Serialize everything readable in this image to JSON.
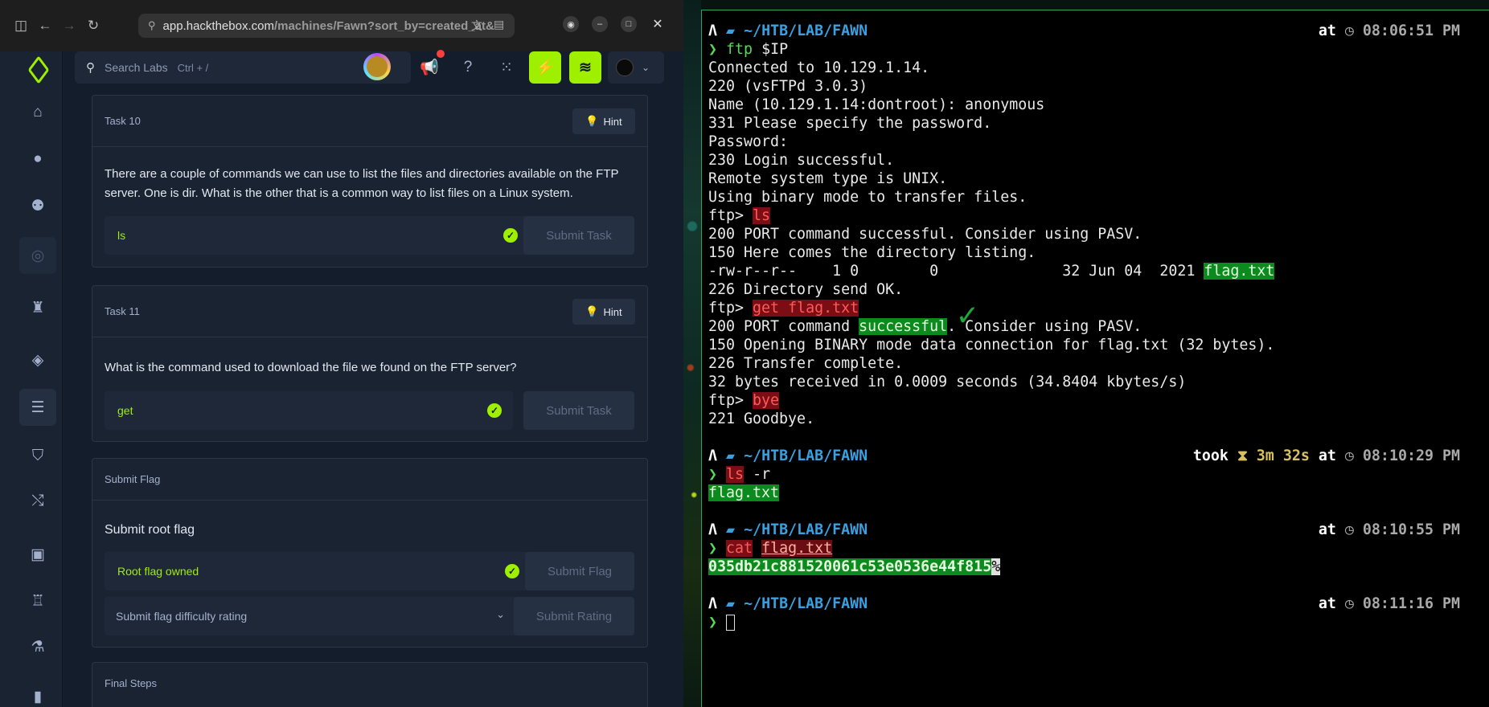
{
  "browser": {
    "url_host": "app.hackthebox.com",
    "url_path": "/machines/Fawn?sort_by=created_at&"
  },
  "topbar": {
    "search_placeholder": "Search Labs",
    "search_shortcut": "Ctrl + /"
  },
  "tasks": [
    {
      "label": "Task 10",
      "hint": "Hint",
      "question": "There are a couple of commands we can use to list the files and directories available on the FTP server. One is dir. What is the other that is a common way to list files on a Linux system.",
      "answer": "ls",
      "submit": "Submit Task"
    },
    {
      "label": "Task 11",
      "hint": "Hint",
      "question": "What is the command used to download the file we found on the FTP server?",
      "answer": "get",
      "submit": "Submit Task"
    }
  ],
  "submit_flag": {
    "label": "Submit Flag",
    "title": "Submit root flag",
    "value": "Root flag owned",
    "submit": "Submit Flag",
    "rating_placeholder": "Submit flag difficulty rating",
    "rating_submit": "Submit Rating"
  },
  "final_steps": {
    "label": "Final Steps"
  },
  "terminal": {
    "path": "~/HTB/LAB/FAWN",
    "at": "at",
    "took": "took",
    "times": [
      "08:06:51 PM",
      "08:10:29 PM",
      "08:10:55 PM",
      "08:11:16 PM"
    ],
    "duration": "3m 32s",
    "cmd1_name": "ftp",
    "cmd1_arg": "$IP",
    "out": [
      "Connected to 10.129.1.14.",
      "220 (vsFTPd 3.0.3)",
      "Name (10.129.1.14:dontroot): anonymous",
      "331 Please specify the password.",
      "Password:",
      "230 Login successful.",
      "Remote system type is UNIX.",
      "Using binary mode to transfer files."
    ],
    "ftp_prompt": "ftp>",
    "ls_cmd": "ls",
    "ls_out1": "200 PORT command successful. Consider using PASV.",
    "ls_out2": "150 Here comes the directory listing.",
    "listing_prefix": "-rw-r--r--    1 0        0              32 Jun 04  2021",
    "listing_file": "flag.txt",
    "ls_out3": "226 Directory send OK.",
    "get_cmd": "get flag.txt",
    "get_out1_a": "200 PORT command ",
    "get_out1_b": "successful",
    "get_out1_c": ". Consider using PASV.",
    "get_out2": "150 Opening BINARY mode data connection for flag.txt (32 bytes).",
    "get_out3": "226 Transfer complete.",
    "get_out4": "32 bytes received in 0.0009 seconds (34.8404 kbytes/s)",
    "bye_cmd": "bye",
    "bye_out": "221 Goodbye.",
    "cmd2_name": "ls",
    "cmd2_arg": "-r",
    "cmd2_out": "flag.txt",
    "cmd3_name": "cat",
    "cmd3_arg": "flag.txt",
    "flag": "035db21c881520061c53e0536e44f815",
    "flag_end": "%",
    "check_mark": "✓"
  },
  "colors": {
    "accent": "#9fef00",
    "panel": "#1a2332",
    "background": "#141d2b",
    "terminal_green": "#57d957",
    "terminal_red_bg": "#7a0e14",
    "terminal_green_bg": "#0b8a1d"
  },
  "icons": {
    "sidebar": [
      "home-icon",
      "user-icon",
      "users-icon",
      "target-icon",
      "castle-icon",
      "direction-icon",
      "machines-icon",
      "shield-icon",
      "pathway-icon",
      "media-icon",
      "fortress-icon",
      "lab-flask-icon",
      "chart-icon"
    ],
    "topbar": [
      "search-icon",
      "megaphone-icon",
      "help-icon",
      "apps-grid-icon",
      "bolt-icon",
      "wifi-icon",
      "chevron-down-icon"
    ]
  }
}
